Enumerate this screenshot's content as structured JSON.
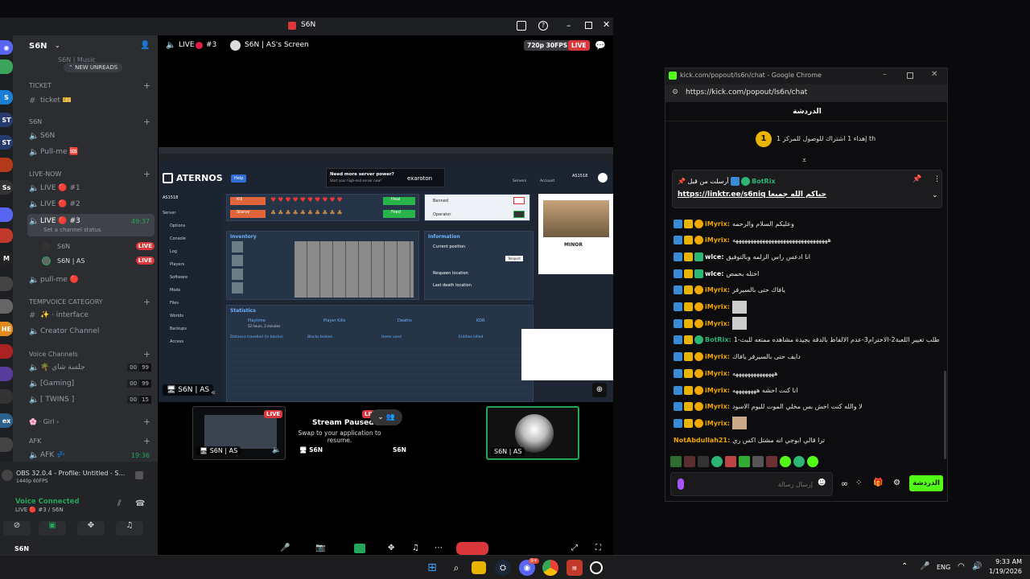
{
  "discord": {
    "window_title": "S6N",
    "server_name": "S6N",
    "new_unreads": "NEW UNREADS",
    "top_partial": "S6N | Music",
    "categories": [
      {
        "name": "TICKET",
        "channels": [
          {
            "type": "text",
            "name": "ticket 🎫"
          }
        ]
      },
      {
        "name": "S6N",
        "channels": [
          {
            "type": "voice",
            "name": "S6N"
          },
          {
            "type": "voice",
            "name": "Pull-me 🆘"
          }
        ]
      },
      {
        "name": "LIVE-NOW",
        "channels": [
          {
            "type": "voice",
            "name": "LIVE 🔴 #1"
          },
          {
            "type": "voice",
            "name": "LIVE 🔴 #2"
          },
          {
            "type": "voice",
            "name": "LIVE 🔴 #3",
            "timer": "49:37",
            "status": "Set a channel status"
          }
        ]
      },
      {
        "name": "TEMPVOICE CATEGORY",
        "channels": [
          {
            "type": "text",
            "name": "✨ · interface"
          },
          {
            "type": "voice",
            "name": "Creator Channel"
          }
        ]
      },
      {
        "name": "Voice Channels",
        "channels": [
          {
            "type": "voice",
            "name": "🌴 جلسة شاي",
            "counts": [
              "00",
              "99"
            ]
          },
          {
            "type": "voice",
            "name": "[Gaming]",
            "counts": [
              "00",
              "99"
            ]
          },
          {
            "type": "voice",
            "name": "[ TWINS ]",
            "counts": [
              "00",
              "15"
            ]
          }
        ]
      },
      {
        "name": "Girl",
        "channels": []
      },
      {
        "name": "AFK",
        "channels": [
          {
            "type": "voice",
            "name": "AFK 💤",
            "timer": "19:36"
          }
        ]
      }
    ],
    "live_users": [
      {
        "name": "S6N",
        "badge": "LIVE"
      },
      {
        "name": "S6N | AS",
        "badge": "LIVE"
      }
    ],
    "pull_me": "pull-me 🔴",
    "obs_title": "OBS 32.0.4 - Profile: Untitled - S...",
    "obs_sub": "1440p 60FPS",
    "voice_connected": "Voice Connected",
    "voice_channel": "LIVE 🔴 #3 / S6N",
    "user_tag": "S6N"
  },
  "stage": {
    "live_label": "LIVE",
    "channel_num": "#3",
    "screen_title": "S6N | AS's Screen",
    "quality": "720p 30FPS",
    "live_badge": "LIVE",
    "tile_name": "S6N | AS",
    "tile_live": "LIVE",
    "paused_title": "Stream Paused",
    "paused_sub": "Swap to your application to resume.",
    "tile2_user": "S6N",
    "tile3_user": "S6N",
    "tile4_user": "S6N | AS",
    "overlay_user": "S6N | AS"
  },
  "aternos": {
    "logo": "ATERNOS",
    "help": "Help",
    "ad_title": "Need more server power?",
    "ad_sub": "Start your high-end server now!",
    "ad_brand": "exaroton",
    "server_id": "AS1518",
    "nav": [
      "Server",
      "Options",
      "Console",
      "Log",
      "Players",
      "Software",
      "Mods",
      "Files",
      "Worlds",
      "Backups",
      "Access"
    ],
    "top_nav": [
      "Servers",
      "Account",
      "AS1518"
    ],
    "tabs": [
      "Kill",
      "Starve",
      "Heal",
      "Feed"
    ],
    "checks": [
      "Banned",
      "Operator"
    ],
    "inventory_title": "Inventory",
    "info_title": "Information",
    "info_rows": [
      "Current position",
      "Respawn location",
      "Last death location"
    ],
    "teleport": "Teleport",
    "stats_title": "Statistics",
    "stat_heads": [
      "Playtime",
      "Player Kills",
      "Deaths",
      "KDR"
    ],
    "playtime": "52 hours, 3 minutes",
    "cols": [
      "Distance travelled (in blocks)",
      "Blocks broken",
      "Items used",
      "Entities killed"
    ],
    "minor": "MINOR"
  },
  "chrome": {
    "title": "kick.com/popout/ls6n/chat - Google Chrome",
    "url": "https://kick.com/popout/ls6n/chat",
    "chat_header": "الدردشة",
    "gift_text": "إهداء 1 اشتراك للوصول للمركز 1 th",
    "gift_rank": "1",
    "pinned_by": "أرسلت من قبل",
    "pinned_user": "BotRix",
    "pinned_msg": "https://linktr.ee/s6niq حياكم الله جميعا",
    "messages": [
      {
        "user": "iMyrix:",
        "color": "#f0a500",
        "text": "وعليكم السلام والرحمه"
      },
      {
        "user": "iMyrix:",
        "color": "#f0a500",
        "text": "ههههههههههههههههههههههههههههههههه"
      },
      {
        "user": "wlce:",
        "color": "#ffffff",
        "text": "انا ادعس راس الزلمه وبالتوفيق"
      },
      {
        "user": "wlce:",
        "color": "#ffffff",
        "text": "اختله بحمص"
      },
      {
        "user": "iMyrix:",
        "color": "#f0a500",
        "text": "يافاك حتى بالسيرفر"
      },
      {
        "user": "iMyrix:",
        "color": "#f0a500",
        "text": ""
      },
      {
        "user": "iMyrix:",
        "color": "#f0a500",
        "text": ""
      },
      {
        "user": "BotRix:",
        "color": "#2bb673",
        "text": "عدم طلب تغيير اللعبة2-الاحترام3-عدم الالفاظ بالدقة بجيدة مشاهده ممتعه للبث-1"
      },
      {
        "user": "iMyrix:",
        "color": "#f0a500",
        "text": "دايف حتى بالسيرفر يافاك"
      },
      {
        "user": "iMyrix:",
        "color": "#f0a500",
        "text": "ههههههههههههههه"
      },
      {
        "user": "iMyrix:",
        "color": "#f0a500",
        "text": "انا كنت احشه ههههههههه"
      },
      {
        "user": "iMyrix:",
        "color": "#f0a500",
        "text": "لا والله كنت اخش بس مخلي الموت لليوم الاسود"
      },
      {
        "user": "iMyrix:",
        "color": "#f0a500",
        "text": ""
      },
      {
        "user": "NotAbdullah21:",
        "color": "#f0a500",
        "text": "ترا قالي ابوجي انه مشتل اكس ري"
      }
    ],
    "input_placeholder": "إرسال رسالة",
    "send_label": "الدردشة"
  },
  "taskbar": {
    "lang": "ENG",
    "time": "9:33 AM",
    "date": "1/19/2026",
    "discord_badge": "9+"
  }
}
